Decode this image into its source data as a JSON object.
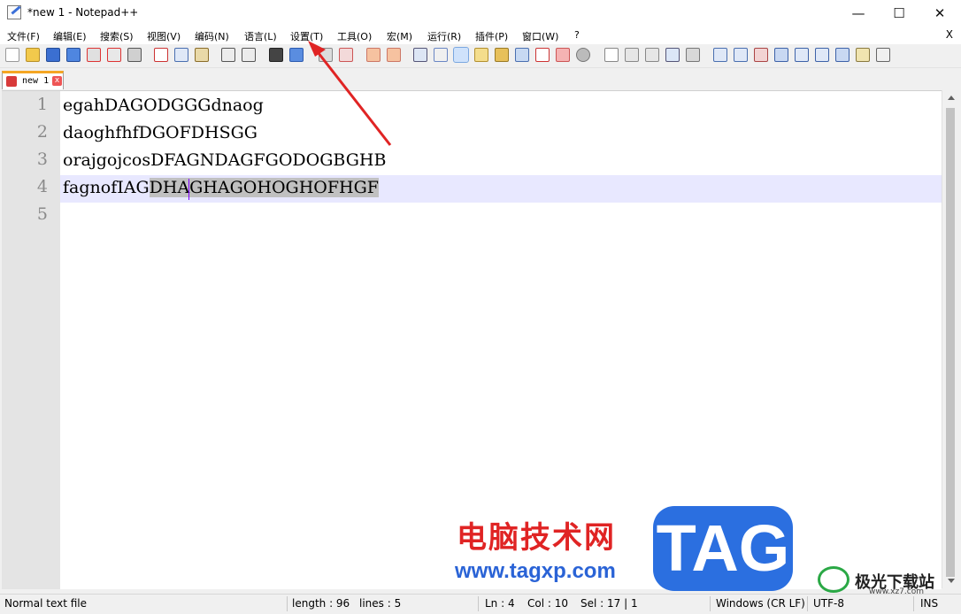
{
  "window": {
    "title": "*new 1 - Notepad++",
    "minimize": "—",
    "maximize": "☐",
    "close": "✕"
  },
  "menu": {
    "items": [
      "文件(F)",
      "编辑(E)",
      "搜索(S)",
      "视图(V)",
      "编码(N)",
      "语言(L)",
      "设置(T)",
      "工具(O)",
      "宏(M)",
      "运行(R)",
      "插件(P)",
      "窗口(W)",
      "?"
    ],
    "close_doc": "X"
  },
  "tab": {
    "label": "new 1",
    "close": "x"
  },
  "editor": {
    "line_numbers": [
      "1",
      "2",
      "3",
      "4",
      "5"
    ],
    "lines": [
      "egahDAGODGGGdnaog",
      "daoghfhfDGOFDHSGG",
      "orajgojcosDFAGNDAGFGODOGBGHB",
      "fagnofIAG",
      ""
    ],
    "line4_selected": "DHAGHAGOHOGHOFHGF"
  },
  "status": {
    "file_type": "Normal text file",
    "length": "length : 96",
    "lines": "lines : 5",
    "ln": "Ln : 4",
    "col": "Col : 10",
    "sel": "Sel : 17 | 1",
    "eol": "Windows (CR LF)",
    "encoding": "UTF-8",
    "mode": "INS"
  },
  "watermarks": {
    "cn_site": "电脑技术网",
    "url": "www.tagxp.com",
    "tag": "TAG",
    "brand2_name": "极光下载站",
    "brand2_url": "www.xz7.com"
  },
  "annotation": {
    "arrow_color": "#e02424",
    "points_to": "设置(T)"
  }
}
